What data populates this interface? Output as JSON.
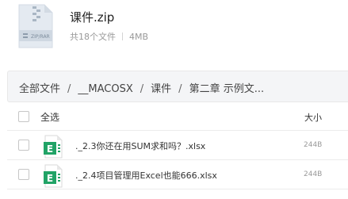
{
  "archive": {
    "name": "课件.zip",
    "file_count": "共18个文件",
    "size": "4MB",
    "icon": "zip-archive-icon",
    "icon_band_text": "ZIP/RAR"
  },
  "breadcrumb": {
    "items": [
      "全部文件",
      "__MACOSX",
      "课件",
      "第二章 示例文..."
    ],
    "separator": "/"
  },
  "table": {
    "select_all_label": "全选",
    "size_header": "大小",
    "rows": [
      {
        "name": "._2.3你还在用SUM求和吗？.xlsx",
        "size": "244B",
        "icon": "excel-file-icon",
        "icon_letter": "E"
      },
      {
        "name": "._2.4项目管理用Excel也能666.xlsx",
        "size": "244B",
        "icon": "excel-file-icon",
        "icon_letter": "E"
      }
    ]
  },
  "colors": {
    "excel_green": "#21a366",
    "breadcrumb_bg": "#f4f5f7",
    "zip_icon": "#dde5ee"
  }
}
